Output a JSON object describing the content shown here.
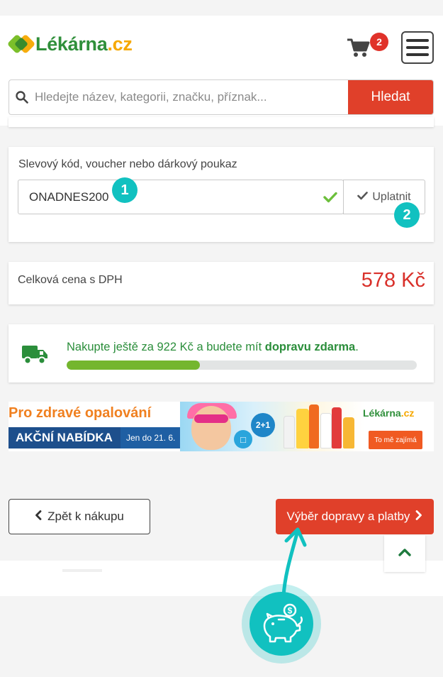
{
  "header": {
    "logo_name": "Lékárna",
    "logo_tld": ".cz",
    "cart_count": "2",
    "search_placeholder": "Hledejte název, kategorii, značku, příznak...",
    "search_button": "Hledat"
  },
  "voucher": {
    "label": "Slevový kód, voucher nebo dárkový poukaz",
    "code": "ONADNES200",
    "apply_label": "Uplatnit",
    "step1": "1",
    "step2": "2"
  },
  "total": {
    "label": "Celková cena s DPH",
    "value": "578 Kč"
  },
  "shipping": {
    "text_before": "Nakupte ještě za 922 Kč a budete mít ",
    "text_bold": "dopravu zdarma",
    "text_after": ".",
    "progress": 0.38
  },
  "banner": {
    "title": "Pro zdravé opalování",
    "action": "AKČNÍ NABÍDKA",
    "date": "Jen do 21. 6.",
    "promo": "2+1",
    "logo_name": "Lékárna",
    "logo_tld": ".cz",
    "cta": "To mě zajímá"
  },
  "nav": {
    "back_label": "Zpět k nákupu",
    "next_label": "Výběr dopravy a platby"
  },
  "colors": {
    "accent_red": "#e0402a",
    "price_red": "#d9302a",
    "brand_green": "#2f8f3a",
    "brand_orange": "#f6a800",
    "teal": "#11c1c0",
    "progress_green": "#74b62e"
  },
  "icons": {
    "cart": "cart-icon",
    "menu": "hamburger-menu-icon",
    "search": "search-icon",
    "valid": "check-icon",
    "apply": "check-icon",
    "truck": "truck-icon",
    "back": "chevron-left-icon",
    "next": "chevron-right-icon",
    "scroll_top": "chevron-up-icon",
    "piggy": "piggy-bank-icon"
  }
}
